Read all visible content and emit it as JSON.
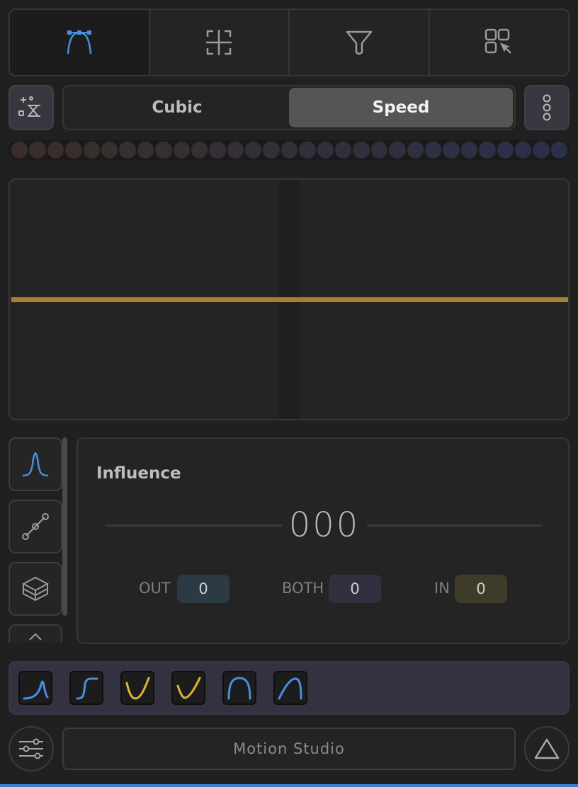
{
  "toolbar": {
    "tabs": [
      {
        "icon": "bezier-curve-icon",
        "active": true
      },
      {
        "icon": "crosshair-frame-icon",
        "active": false
      },
      {
        "icon": "funnel-icon",
        "active": false
      },
      {
        "icon": "grid-select-icon",
        "active": false
      }
    ]
  },
  "mode": {
    "options": [
      "Cubic",
      "Speed"
    ],
    "selected": "Speed"
  },
  "dots": {
    "count": 31,
    "from_color": "#3a2e29",
    "to_color": "#2a3049"
  },
  "graph": {
    "line_color": "#a57f2d"
  },
  "side_tabs": [
    {
      "icon": "bell-curve-icon"
    },
    {
      "icon": "linked-nodes-icon"
    },
    {
      "icon": "layers-cube-icon"
    },
    {
      "icon": "chevron-up-icon"
    }
  ],
  "influence": {
    "title": "Influence",
    "value": "000",
    "fields": [
      {
        "label": "OUT",
        "value": "0",
        "color": "#2c3b43"
      },
      {
        "label": "BOTH",
        "value": "0",
        "color": "#31303e"
      },
      {
        "label": "IN",
        "value": "0",
        "color": "#3e3c28"
      }
    ]
  },
  "presets": [
    {
      "icon": "ease-spike-icon",
      "color": "#4b8ee0"
    },
    {
      "icon": "ease-step-icon",
      "color": "#4b8ee0"
    },
    {
      "icon": "ease-in-curve-icon",
      "color": "#e0b336"
    },
    {
      "icon": "ease-out-curve-icon",
      "color": "#e0b336"
    },
    {
      "icon": "arch-curve-icon",
      "color": "#4b8ee0"
    },
    {
      "icon": "rise-arch-icon",
      "color": "#4b8ee0"
    }
  ],
  "footer": {
    "title": "Motion Studio",
    "left_icon": "sliders-icon",
    "right_icon": "triangle-up-icon",
    "accent": "#3b7fc9"
  }
}
